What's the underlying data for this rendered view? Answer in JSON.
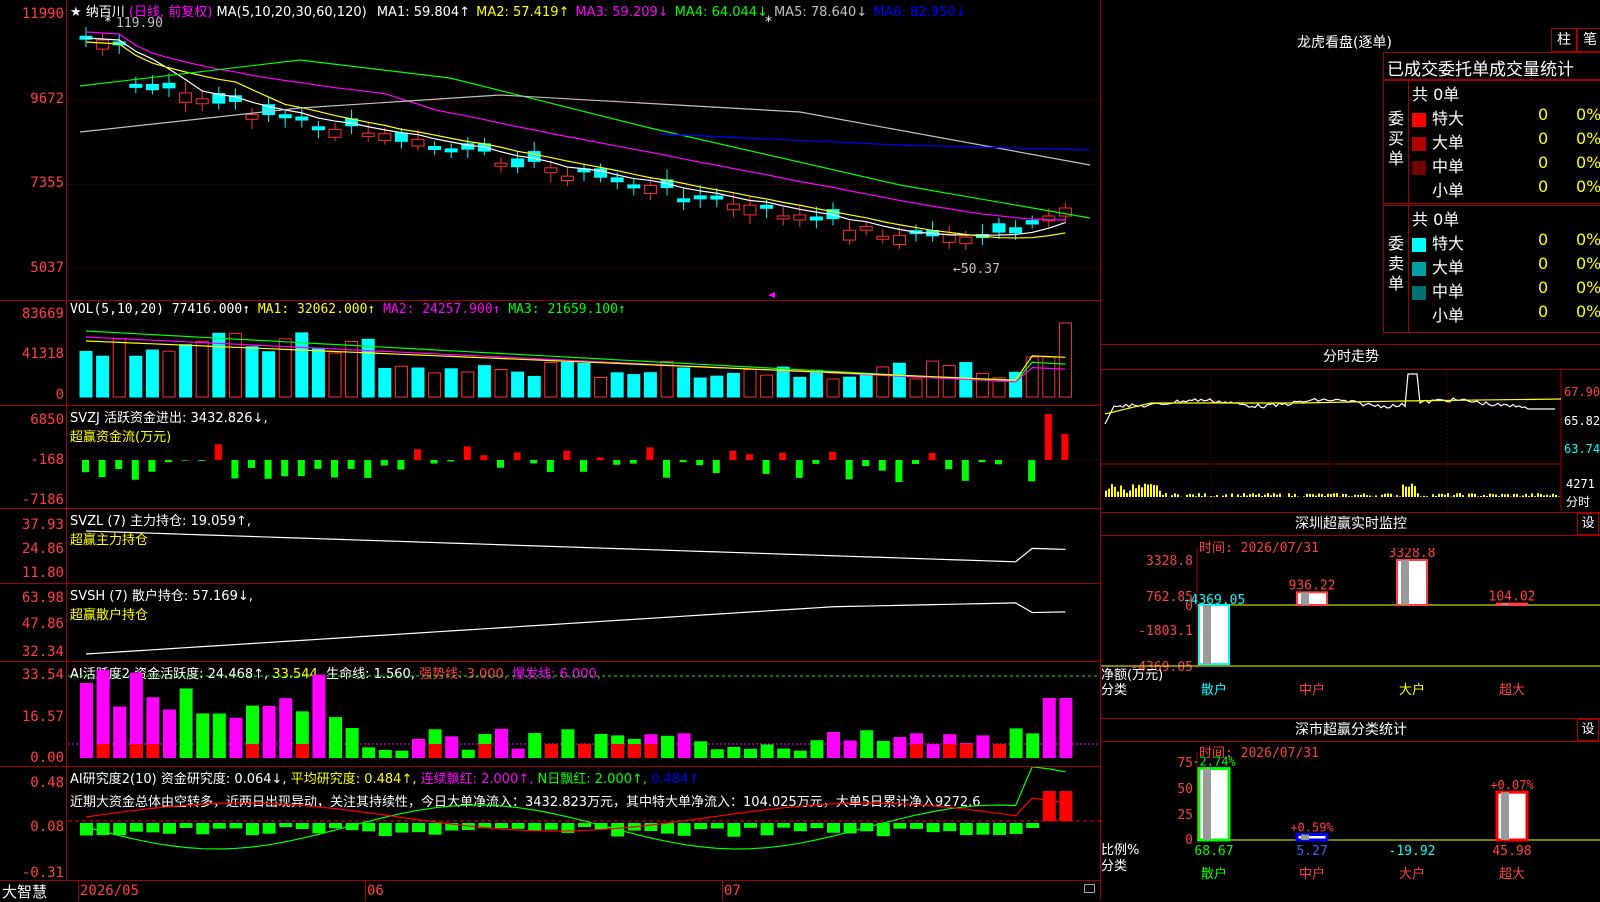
{
  "main": {
    "stock": "纳百川",
    "mode": "(日线, 前复权)",
    "ma_label": "MA(5,10,20,30,60,120)",
    "ma": [
      {
        "name": "MA1:",
        "value": "59.804↑",
        "color": "#ffffff"
      },
      {
        "name": "MA2:",
        "value": "57.419↑",
        "color": "#ffff00"
      },
      {
        "name": "MA3:",
        "value": "59.209↓",
        "color": "#ff00ff"
      },
      {
        "name": "MA4:",
        "value": "64.044↓",
        "color": "#00ff00"
      },
      {
        "name": "MA5:",
        "value": "78.640↓",
        "color": "#c0c0c0"
      },
      {
        "name": "MA6:",
        "value": "82.950↓",
        "color": "#0000ff"
      }
    ],
    "high_label": "119.90",
    "low_label": "←50.37",
    "yticks": [
      "11990",
      "9672",
      "7355",
      "5037"
    ]
  },
  "vol": {
    "label": "VOL(5,10,20)",
    "value": "77416.000↑",
    "ma1": "MA1: 32062.000↑",
    "ma2": "MA2: 24257.900↑",
    "ma3": "MA3: 21659.100↑",
    "yticks": [
      "83669",
      "41318",
      "0"
    ]
  },
  "svzj": {
    "label": "SVZJ  活跃资金进出: 3432.826↓,",
    "sub": "超赢资金流(万元)",
    "yticks": [
      "6850",
      "-168",
      "-7186"
    ]
  },
  "svzl": {
    "label": "SVZL (7) 主力持仓: 19.059↑,",
    "sub": "超赢主力持仓",
    "yticks": [
      "37.93",
      "24.86",
      "11.80"
    ]
  },
  "svsh": {
    "label": "SVSH (7) 散户持仓: 57.169↓,",
    "sub": "超赢散户持仓",
    "yticks": [
      "63.98",
      "47.86",
      "32.34"
    ]
  },
  "ai_active": {
    "label1": "AI活跃度2 资金活跃度: 24.468↑,",
    "v2": "33.544,",
    "label3": "生命线: 1.560,",
    "strong": "强势线: 3.000,",
    "burst": "爆发线: 6.000,",
    "yticks": [
      "33.54",
      "16.57",
      "0.00"
    ]
  },
  "ai_research": {
    "label1": "AI研究度2(10) 资金研究度: 0.064↓,",
    "avg": "平均研究度: 0.484↑,",
    "cont": "连续飘红: 2.000↑,",
    "nday": "N日飘红: 2.000↑,",
    "last": "0.484↑",
    "comment": "近期大资金总体由空转多，近两日出现异动，关注其持续性，今日大单净流入：3432.823万元，其中特大单净流入：104.025万元，大单5日累计净入9272.6",
    "yticks": [
      "0.48",
      "0.08",
      "-0.31"
    ]
  },
  "footer": {
    "brand": "大智慧",
    "dates": [
      "2026/05",
      "06",
      "07"
    ]
  },
  "right": {
    "header": "龙虎看盘(逐单)",
    "btn1": "柱",
    "btn2": "笔",
    "tab_title": "已成交委托单成交量统计",
    "buy": {
      "side_label": "委买单",
      "total": "共 0单",
      "rows": [
        {
          "name": "特大",
          "count": "0",
          "pct": "0%",
          "color": "#ff0000"
        },
        {
          "name": "大单",
          "count": "0",
          "pct": "0%",
          "color": "#b00000"
        },
        {
          "name": "中单",
          "count": "0",
          "pct": "0%",
          "color": "#700000"
        },
        {
          "name": "小单",
          "count": "0",
          "pct": "0%",
          "color": "#000000"
        }
      ]
    },
    "sell": {
      "side_label": "委卖单",
      "total": "共 0单",
      "rows": [
        {
          "name": "特大",
          "count": "0",
          "pct": "0%",
          "color": "#00ffff"
        },
        {
          "name": "大单",
          "count": "0",
          "pct": "0%",
          "color": "#00a0a0"
        },
        {
          "name": "中单",
          "count": "0",
          "pct": "0%",
          "color": "#006f70"
        },
        {
          "name": "小单",
          "count": "0",
          "pct": "0%",
          "color": "#000000"
        }
      ]
    },
    "intraday": {
      "title": "分时走势",
      "prices": [
        "67.90",
        "65.82",
        "63.74"
      ],
      "vol": "4271",
      "vol_unit": "分时"
    },
    "monitor": {
      "title": "深圳超赢实时监控",
      "settings": "设",
      "date": "时间: 2026/07/31",
      "yticks": [
        "3328.8",
        "762.85",
        "0",
        "-1803.1",
        "-4369.05"
      ],
      "ylabel": "净额(万元)",
      "xlabel": "分类",
      "categories": [
        "散户",
        "中户",
        "大户",
        "超大"
      ],
      "values": [
        -4369.05,
        936.22,
        3328.8,
        104.02
      ],
      "labels": [
        "-4369.05",
        "936.22",
        "3328.8",
        "104.02"
      ]
    },
    "classify": {
      "title": "深市超赢分类统计",
      "settings": "设",
      "date": "时间: 2026/07/31",
      "yticks": [
        "75",
        "50",
        "25",
        "0"
      ],
      "ylabel": "比例%",
      "xlabel": "分类",
      "categories": [
        "散户",
        "中户",
        "大户",
        "超大"
      ],
      "values": [
        68.67,
        5.27,
        -19.92,
        45.98
      ],
      "changes": [
        "-2.74%",
        "+0.59%",
        "",
        "+0.07%"
      ]
    }
  }
}
